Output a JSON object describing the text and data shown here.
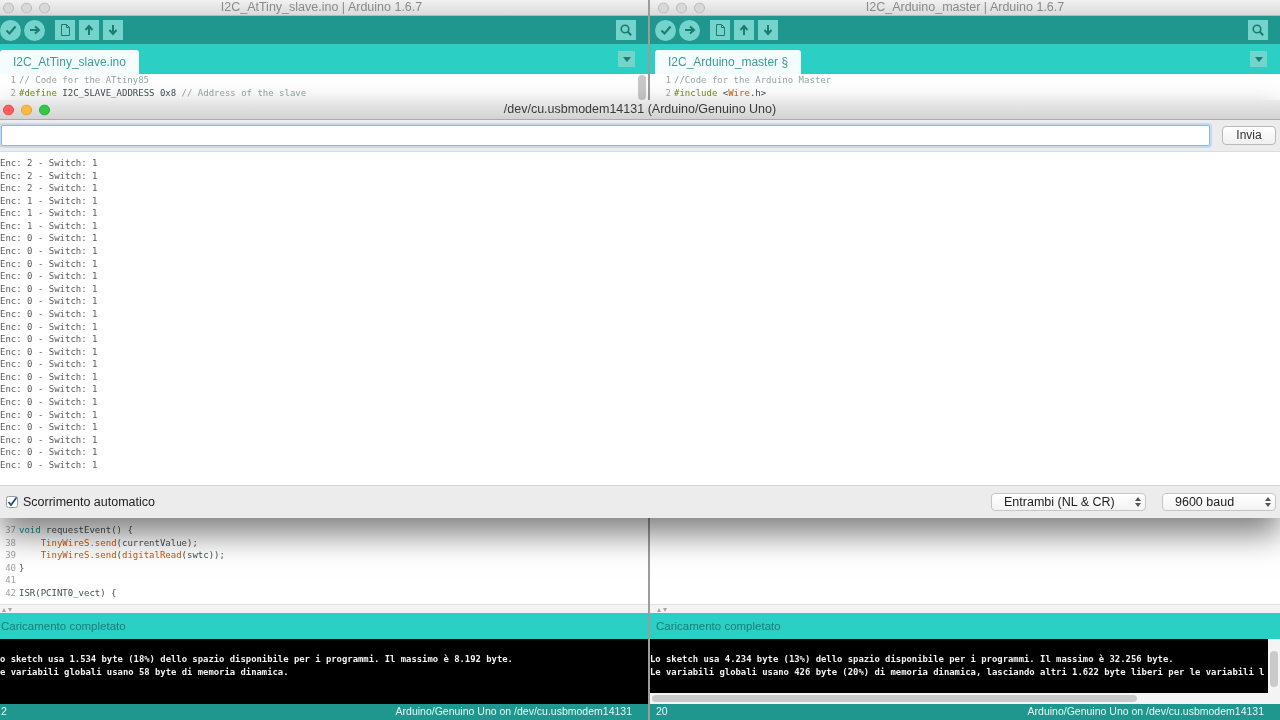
{
  "ide_windows": [
    {
      "title": "I2C_AtTiny_slave.ino | Arduino 1.6.7",
      "active": false,
      "tabs": [
        {
          "label": "I2C_AtTiny_slave.ino",
          "selected": true
        }
      ],
      "code_top": [
        {
          "number": "1",
          "segments": [
            {
              "kind": "comment",
              "text": "// Code for the ATtiny85"
            }
          ]
        },
        {
          "number": "2",
          "segments": [
            {
              "kind": "preprocessor",
              "text": "#define"
            },
            {
              "kind": "plain",
              "text": " I2C_SLAVE_ADDRESS 0x8 "
            },
            {
              "kind": "comment",
              "text": "// Address of the slave"
            }
          ]
        }
      ],
      "code_bottom": [
        {
          "number": "37",
          "segments": [
            {
              "kind": "keyword",
              "text": "void"
            },
            {
              "kind": "plain",
              "text": " requestEvent() {"
            }
          ],
          "children": [
            {
              "number": "38",
              "segments": [
                {
                  "kind": "function",
                  "text": "TinyWireS.send"
                },
                {
                  "kind": "plain",
                  "text": "(currentValue);"
                }
              ]
            },
            {
              "number": "39",
              "segments": [
                {
                  "kind": "function",
                  "text": "TinyWireS.send"
                },
                {
                  "kind": "plain",
                  "text": "("
                },
                {
                  "kind": "function",
                  "text": "digitalRead"
                },
                {
                  "kind": "plain",
                  "text": "(swtc));"
                }
              ]
            }
          ]
        },
        {
          "number": "40",
          "segments": [
            {
              "kind": "plain",
              "text": "}"
            }
          ]
        },
        {
          "number": "41"
        },
        {
          "number": "42",
          "segments": [
            {
              "kind": "plain",
              "text": "ISR(PCINT0_vect) {"
            }
          ]
        }
      ],
      "status_message": "Caricamento completato",
      "console_lines": [
        "o sketch usa 1.534 byte (18%) dello spazio disponibile per i programmi. Il massimo è 8.192 byte.",
        "e variabili globali usano 58 byte di memoria dinamica."
      ],
      "footer": {
        "line": "2",
        "board": "Arduino/Genuino Uno on /dev/cu.usbmodem14131"
      }
    },
    {
      "title": "I2C_Arduino_master | Arduino 1.6.7",
      "active": false,
      "tabs": [
        {
          "label": "I2C_Arduino_master §",
          "selected": true
        }
      ],
      "code_top": [
        {
          "number": "1",
          "segments": [
            {
              "kind": "comment",
              "text": "//Code for the Arduino Master"
            }
          ]
        },
        {
          "number": "2",
          "segments": [
            {
              "kind": "preprocessor",
              "text": "#include"
            },
            {
              "kind": "plain",
              "text": " <"
            },
            {
              "kind": "function",
              "text": "Wire"
            },
            {
              "kind": "plain",
              "text": ".h>"
            }
          ]
        }
      ],
      "status_message": "Caricamento completato",
      "console_lines": [
        "Lo sketch usa 4.234 byte (13%) dello spazio disponibile per i programmi. Il massimo è 32.256 byte.",
        "Le variabili globali usano 426 byte (20%) di memoria dinamica, lasciando altri 1.622 byte liberi per le variabili l"
      ],
      "footer": {
        "line": "20",
        "board": "Arduino/Genuino Uno on /dev/cu.usbmodem14131"
      }
    }
  ],
  "serial_monitor": {
    "title": "/dev/cu.usbmodem14131 (Arduino/Genuino Uno)",
    "active": true,
    "send_button": "Invia",
    "output_lines": [
      "Enc: 2 - Switch: 1",
      "Enc: 2 - Switch: 1",
      "Enc: 2 - Switch: 1",
      "Enc: 1 - Switch: 1",
      "Enc: 1 - Switch: 1",
      "Enc: 1 - Switch: 1",
      "Enc: 0 - Switch: 1",
      "Enc: 0 - Switch: 1",
      "Enc: 0 - Switch: 1",
      "Enc: 0 - Switch: 1",
      "Enc: 0 - Switch: 1",
      "Enc: 0 - Switch: 1",
      "Enc: 0 - Switch: 1",
      "Enc: 0 - Switch: 1",
      "Enc: 0 - Switch: 1",
      "Enc: 0 - Switch: 1",
      "Enc: 0 - Switch: 1",
      "Enc: 0 - Switch: 1",
      "Enc: 0 - Switch: 1",
      "Enc: 0 - Switch: 1",
      "Enc: 0 - Switch: 1",
      "Enc: 0 - Switch: 1",
      "Enc: 0 - Switch: 1",
      "Enc: 0 - Switch: 1",
      "Enc: 0 - Switch: 1"
    ],
    "autoscroll": {
      "label": "Scorrimento automatico",
      "checked": true
    },
    "line_ending": "Entrambi (NL & CR)",
    "baud_rate": "9600 baud"
  }
}
